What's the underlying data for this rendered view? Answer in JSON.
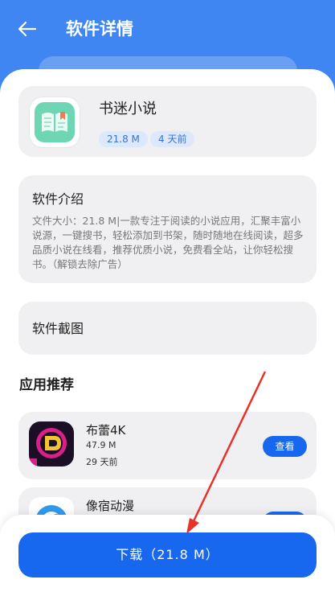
{
  "header": {
    "title": "软件详情",
    "back_icon": "arrow-left-icon"
  },
  "app": {
    "name": "书迷小说",
    "icon": "book-icon",
    "tags": [
      "21.8 M",
      "4 天前"
    ]
  },
  "intro": {
    "title": "软件介绍",
    "text": "文件大小：21.8 M|一款专注于阅读的小说应用，汇聚丰富小说源，一键搜书，轻松添加到书架，随时随地在线阅读，超多品质小说在线看，推荐优质小说，免费看全站，让你轻松搜书。（解锁去除广告）"
  },
  "screenshots": {
    "title": "软件截图"
  },
  "recommend": {
    "title": "应用推荐",
    "items": [
      {
        "name": "布蕾4K",
        "size": "47.9 M",
        "time": "29 天前",
        "button": "查看"
      },
      {
        "name": "像宿动漫",
        "size": "",
        "time": "",
        "button": ""
      }
    ]
  },
  "download": {
    "label": "下载（21.8 M）"
  },
  "colors": {
    "primary": "#1768ef",
    "header": "#3f86f3",
    "card": "#f0f0f2",
    "annotation": "#e8312a"
  }
}
